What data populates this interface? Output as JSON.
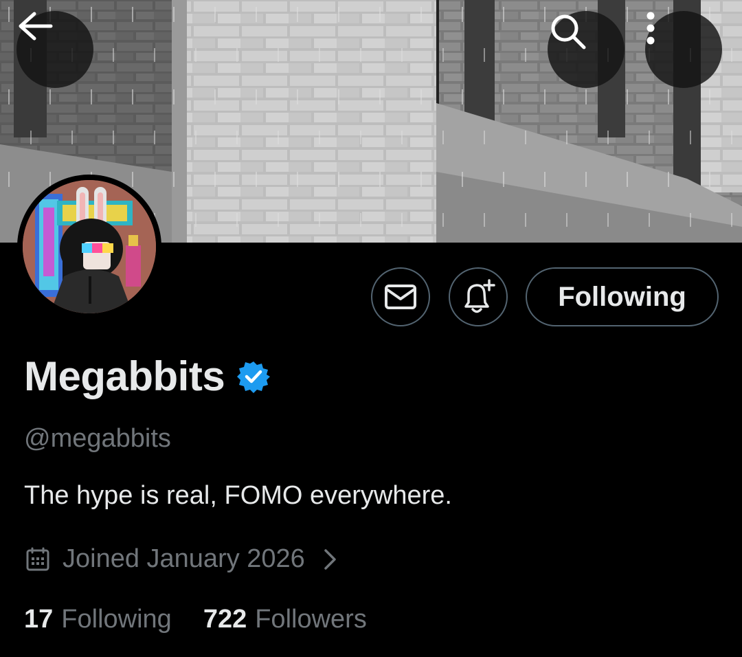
{
  "header": {
    "back_icon": "arrow-left-icon",
    "search_icon": "search-icon",
    "more_icon": "more-vertical-icon"
  },
  "actions": {
    "message_icon": "mail-icon",
    "notify_icon": "bell-plus-icon",
    "follow_label": "Following"
  },
  "profile": {
    "display_name": "Megabbits",
    "verified": true,
    "verified_color": "#1d9bf0",
    "handle": "@megabbits",
    "bio": "The hype is real, FOMO everywhere.",
    "joined": "Joined January 2026"
  },
  "stats": {
    "following_count": "17",
    "following_label": "Following",
    "followers_count": "722",
    "followers_label": "Followers"
  },
  "colors": {
    "background": "#000000",
    "primary_text": "#e7e9ea",
    "secondary_text": "#71767b",
    "border": "#536471"
  }
}
